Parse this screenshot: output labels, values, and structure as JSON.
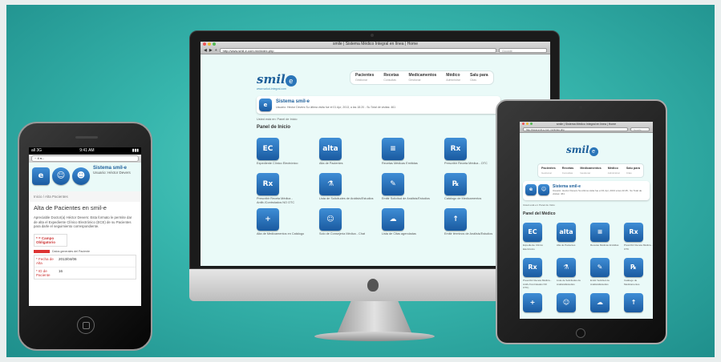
{
  "imac": {
    "title": "smile | Sistema Médico Integral en línea | Home",
    "url": "http://www.smil-e.com.mx/index.php",
    "search_placeholder": "Google",
    "logo_text": "smil",
    "logo_tagline": "www.salud-integral.com",
    "nav": [
      {
        "label": "Pacientes",
        "sub": "Gestionar"
      },
      {
        "label": "Recetas",
        "sub": "Consultas"
      },
      {
        "label": "Medicamentos",
        "sub": "Gestionar"
      },
      {
        "label": "Médico",
        "sub": "Administrar"
      },
      {
        "label": "Salu para",
        "sub": "Citas"
      }
    ],
    "system_title": "Sistema smil-e",
    "system_sub": "Usuario: Hector Devers  Su última visita fue el 01 Apr, 2013, a las 18:20 - Su Total de visitas: 461",
    "breadcrumb": "Usted está en: Panel de Inicio",
    "panel_title": "Panel de Inicio",
    "icons": [
      {
        "label": "Expediente Clínico Electrónico",
        "glyph": "EC"
      },
      {
        "label": "Alta de Pacientes",
        "glyph": "alta"
      },
      {
        "label": "Recetas Médicas Emitidas",
        "glyph": "≡"
      },
      {
        "label": "Prescribir Receta Médica - OTC",
        "glyph": "Rx"
      },
      {
        "label": "Prescribir Receta Médica - Antib./Controlados NO OTC",
        "glyph": "Rx"
      },
      {
        "label": "Lista de Solicitudes de Análisis/Estudios",
        "glyph": "⚗"
      },
      {
        "label": "Emitir Solicitud de Análisis/Estudios",
        "glyph": "✎"
      },
      {
        "label": "Catálogo de Medicamentos",
        "glyph": "℞"
      },
      {
        "label": "Alta de Medicamentos en Catálogo",
        "glyph": "+"
      },
      {
        "label": "Solo de Consejería Médica - Chat",
        "glyph": "☺"
      },
      {
        "label": "Lista de Citas agendadas",
        "glyph": "☁"
      },
      {
        "label": "Emitir términos de Análisis/Estudios",
        "glyph": "↑"
      }
    ]
  },
  "ipad": {
    "title": "smile | Sistema Médico Integral en línea | Home",
    "url": "http://www.smil-e.com.mx/index.php",
    "search_placeholder": "Google",
    "nav": [
      {
        "label": "Pacientes",
        "sub": "Gestionar"
      },
      {
        "label": "Recetas",
        "sub": "Consultas"
      },
      {
        "label": "Medicamentos",
        "sub": "Gestionar"
      },
      {
        "label": "Médico",
        "sub": "Administrar"
      },
      {
        "label": "Salu para",
        "sub": "Citas"
      }
    ],
    "system_title": "Sistema smil-e",
    "system_sub": "Usuario: Hector Devers  Su última visita fue el 01 Apr, 2013 a las 22:28 - Su Total de visitas: 461",
    "breadcrumb": "Usted está en: Panel de Inicio",
    "panel_title": "Panel del Médico",
    "icons": [
      {
        "label": "Expediente Clínico Electrónico",
        "glyph": "EC"
      },
      {
        "label": "Alta de Pacientes",
        "glyph": "alta"
      },
      {
        "label": "Recetas Médicas Emitidas",
        "glyph": "≡"
      },
      {
        "label": "Prescribir Receta Médica - OTC",
        "glyph": "Rx"
      },
      {
        "label": "Prescribir Receta Médica - Antib./Controlados NO OTC)",
        "glyph": "Rx"
      },
      {
        "label": "Lista de Solicitudes de Análisis/Estudios",
        "glyph": "⚗"
      },
      {
        "label": "Emitir Solicitud de Análisis/Estudios",
        "glyph": "✎"
      },
      {
        "label": "Catálogo de Medicamentos",
        "glyph": "℞"
      },
      {
        "label": "",
        "glyph": "+"
      },
      {
        "label": "",
        "glyph": "☺"
      },
      {
        "label": "",
        "glyph": "☁"
      },
      {
        "label": "",
        "glyph": "↑"
      }
    ]
  },
  "iphone": {
    "carrier": "all 3G",
    "time": "9:41 AM",
    "battery": "▮▮▮",
    "url_stub": "~ 4 n...",
    "system_title": "Sistema smil-e",
    "system_sub": "Usuario: Héctor Devers",
    "breadcrumb": "Inicio / Alta Pacientes",
    "page_title": "Alta de Pacientes en smil-e",
    "intro": "Apreciable Doctor(a) Héctor Devers: Esta formato le permite dar de alta el Expediente Clínico Electrónico (ECE) de su Pacientes para darle el seguimiento correspondiente.",
    "required_note": "* = Campo Obligatorio",
    "section_header": "Datos generales del Paciente",
    "fields": [
      {
        "label": "* Fecha de Alta",
        "value": "2013/04/06"
      },
      {
        "label": "* ID de Paciente",
        "value": "16"
      }
    ]
  },
  "colors": {
    "accent": "#1d5f9a",
    "icon_blue": "#2a75b8",
    "screen_bg": "#eafaf8",
    "backdrop": "#37b6ad"
  }
}
